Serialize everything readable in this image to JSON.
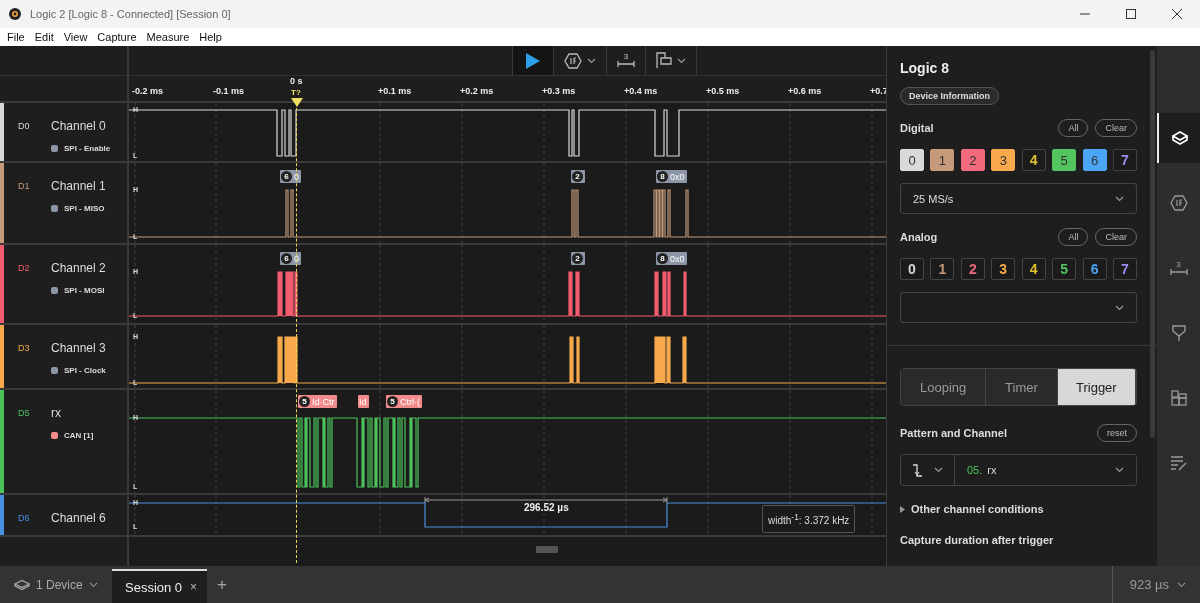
{
  "window": {
    "title": "Logic 2 [Logic 8 - Connected] [Session 0]"
  },
  "menu": [
    "File",
    "Edit",
    "View",
    "Capture",
    "Measure",
    "Help"
  ],
  "toolbar": [
    {
      "kind": "play"
    },
    {
      "kind": "analyzers",
      "caret": true
    },
    {
      "kind": "measure",
      "badge": "3",
      "caret": false
    },
    {
      "kind": "markers",
      "caret": true
    }
  ],
  "ruler": {
    "zero": "0 s",
    "trigger": "T?",
    "ticks": [
      "-0.2 ms",
      "-0.1 ms",
      "+0.1 ms",
      "+0.2 ms",
      "+0.3 ms",
      "+0.4 ms",
      "+0.5 ms",
      "+0.6 ms",
      "+0.7"
    ]
  },
  "channels": [
    {
      "id": "D0",
      "name": "Channel 0",
      "color": "#d9d9d9",
      "high": "H",
      "low": "L",
      "analyzer": {
        "name": "SPI - Enable",
        "color": "#8d96a8"
      }
    },
    {
      "id": "D1",
      "name": "Channel 1",
      "color": "#c49a7a",
      "high": "H",
      "low": "L",
      "analyzer": {
        "name": "SPI - MISO",
        "color": "#8d96a8"
      },
      "frames": [
        {
          "index": "6",
          "value": "0"
        },
        {
          "index": "2"
        },
        {
          "index": "8",
          "value": "0x0"
        }
      ]
    },
    {
      "id": "D2",
      "name": "Channel 2",
      "color": "#f25c6e",
      "high": "H",
      "low": "L",
      "analyzer": {
        "name": "SPI - MOSI",
        "color": "#8d96a8"
      },
      "frames": [
        {
          "index": "6",
          "value": "0"
        },
        {
          "index": "2"
        },
        {
          "index": "8",
          "value": "0x0"
        }
      ]
    },
    {
      "id": "D3",
      "name": "Channel 3",
      "color": "#f7a94b",
      "high": "H",
      "low": "L",
      "analyzer": {
        "name": "SPI - Clock",
        "color": "#8d96a8"
      }
    },
    {
      "id": "D5",
      "name": "rx",
      "color": "#4cc35a",
      "high": "H",
      "low": "L",
      "analyzer": {
        "name": "CAN [1]",
        "color": "#f28b8b"
      },
      "frames": [
        {
          "index": "5",
          "value": "Id·Ctr"
        },
        {
          "value": "Id"
        },
        {
          "index": "5",
          "value": "Ctrl·("
        }
      ]
    },
    {
      "id": "D6",
      "name": "Channel 6",
      "color": "#4a90e2",
      "high": "H",
      "low": "L",
      "measurement": {
        "value": "296.52 µs",
        "tooltip": "width$^{-1}$: 3.372 kHz"
      }
    }
  ],
  "panel": {
    "title": "Logic 8",
    "device_info": "Device Information",
    "digital": {
      "label": "Digital",
      "all": "All",
      "clear": "Clear",
      "sample_rate": "25 MS/s",
      "channels": [
        {
          "label": "0",
          "enabled": true,
          "color": "#d9d9d9"
        },
        {
          "label": "1",
          "enabled": true,
          "color": "#c49a7a"
        },
        {
          "label": "2",
          "enabled": true,
          "color": "#f26a7c"
        },
        {
          "label": "3",
          "enabled": true,
          "color": "#f7a94b"
        },
        {
          "label": "4",
          "enabled": false,
          "color": "#e0c030"
        },
        {
          "label": "5",
          "enabled": true,
          "color": "#52c460"
        },
        {
          "label": "6",
          "enabled": true,
          "color": "#4ca4f5"
        },
        {
          "label": "7",
          "enabled": false,
          "color": "#9b8cf0"
        }
      ]
    },
    "analog": {
      "label": "Analog",
      "all": "All",
      "clear": "Clear",
      "channels": [
        {
          "label": "0",
          "enabled": false,
          "color": "#d9d9d9"
        },
        {
          "label": "1",
          "enabled": false,
          "color": "#c49a7a"
        },
        {
          "label": "2",
          "enabled": false,
          "color": "#f26a7c"
        },
        {
          "label": "3",
          "enabled": false,
          "color": "#f7a94b"
        },
        {
          "label": "4",
          "enabled": false,
          "color": "#e0c030"
        },
        {
          "label": "5",
          "enabled": false,
          "color": "#52c460"
        },
        {
          "label": "6",
          "enabled": false,
          "color": "#4ca4f5"
        },
        {
          "label": "7",
          "enabled": false,
          "color": "#9b8cf0"
        }
      ]
    },
    "modes": [
      {
        "label": "Looping",
        "selected": false
      },
      {
        "label": "Timer",
        "selected": false
      },
      {
        "label": "Trigger",
        "selected": true
      }
    ],
    "pattern": {
      "label": "Pattern and Channel",
      "reset": "reset",
      "channel_number": "05.",
      "channel_name": "rx"
    },
    "other_conditions": {
      "label": "Other channel conditions",
      "expanded": false
    },
    "capture_duration": "Capture duration after trigger"
  },
  "rail": [
    {
      "kind": "device",
      "selected": true
    },
    {
      "kind": "analyzers",
      "selected": false
    },
    {
      "kind": "measure",
      "badge": "3",
      "selected": false
    },
    {
      "kind": "marker",
      "selected": false
    },
    {
      "kind": "grid",
      "selected": false
    },
    {
      "kind": "notes",
      "selected": false
    }
  ],
  "tabs": {
    "device": "1 Device",
    "sessions": [
      {
        "label": "Session 0",
        "close": "×",
        "selected": true
      }
    ],
    "add": "+",
    "duration": "923 µs"
  }
}
